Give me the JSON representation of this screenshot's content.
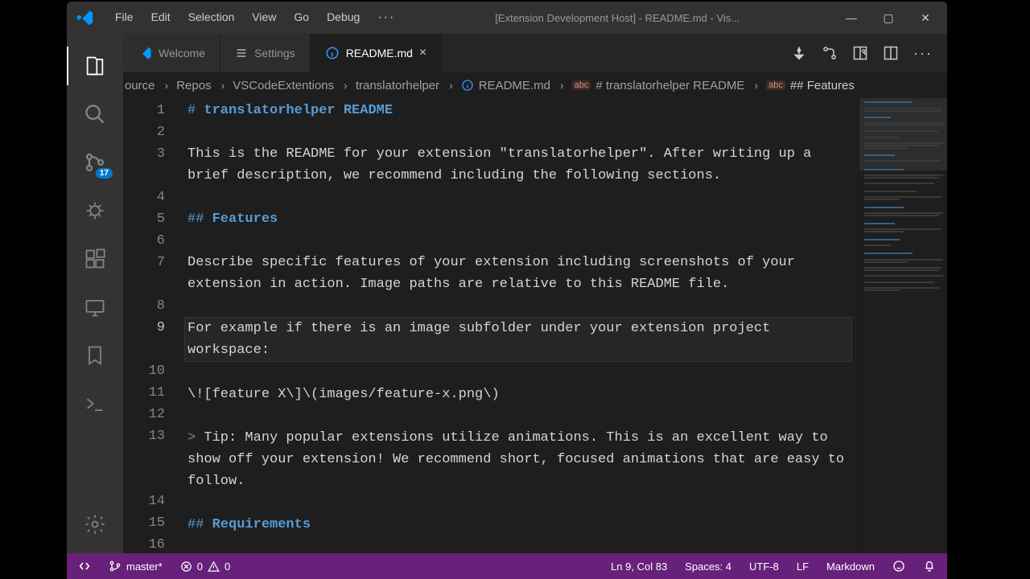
{
  "titlebar": {
    "menus": [
      "File",
      "Edit",
      "Selection",
      "View",
      "Go",
      "Debug"
    ],
    "title": "[Extension Development Host] - README.md - Vis..."
  },
  "activitybar": {
    "scm_badge": "17"
  },
  "tabs": [
    {
      "label": "Welcome",
      "active": false,
      "closeable": false
    },
    {
      "label": "Settings",
      "active": false,
      "closeable": false
    },
    {
      "label": "README.md",
      "active": true,
      "closeable": true
    }
  ],
  "breadcrumb": {
    "parts": [
      "ource",
      "Repos",
      "VSCodeExtentions",
      "translatorhelper",
      "README.md",
      "# translatorhelper README",
      "## Features"
    ]
  },
  "editor": {
    "lines": [
      {
        "n": "1",
        "html": [
          {
            "cls": "mk-hash",
            "t": "#"
          },
          {
            "cls": "mk-head",
            "t": " translatorhelper README"
          }
        ]
      },
      {
        "n": "2",
        "html": []
      },
      {
        "n": "3",
        "html": [
          {
            "cls": "mk-text",
            "t": "This is the README for your extension \"translatorhelper\". After writing up a brief description, we recommend including the following sections."
          }
        ]
      },
      {
        "n": "4",
        "html": []
      },
      {
        "n": "5",
        "html": [
          {
            "cls": "mk-hash",
            "t": "##"
          },
          {
            "cls": "mk-head",
            "t": " Features"
          }
        ]
      },
      {
        "n": "6",
        "html": []
      },
      {
        "n": "7",
        "html": [
          {
            "cls": "mk-text",
            "t": "Describe specific features of your extension including screenshots of your extension in action. Image paths are relative to this README file."
          }
        ]
      },
      {
        "n": "8",
        "html": []
      },
      {
        "n": "9",
        "active": true,
        "html": [
          {
            "cls": "mk-text",
            "t": "For example if there is an image subfolder under your extension project workspace:"
          }
        ]
      },
      {
        "n": "10",
        "html": []
      },
      {
        "n": "11",
        "html": [
          {
            "cls": "mk-text",
            "t": "\\![feature X\\]\\(images/feature-x.png\\)"
          }
        ]
      },
      {
        "n": "12",
        "html": []
      },
      {
        "n": "13",
        "html": [
          {
            "cls": "mk-quote",
            "t": ">"
          },
          {
            "cls": "mk-text",
            "t": " Tip: Many popular extensions utilize animations. This is an excellent way to show off your extension! We recommend short, focused animations that are easy to follow."
          }
        ]
      },
      {
        "n": "14",
        "html": []
      },
      {
        "n": "15",
        "html": [
          {
            "cls": "mk-hash",
            "t": "##"
          },
          {
            "cls": "mk-head",
            "t": " Requirements"
          }
        ]
      },
      {
        "n": "16",
        "html": []
      }
    ]
  },
  "statusbar": {
    "branch": "master*",
    "errors": "0",
    "warnings": "0",
    "position": "Ln 9, Col 83",
    "spaces": "Spaces: 4",
    "encoding": "UTF-8",
    "eol": "LF",
    "lang": "Markdown"
  }
}
